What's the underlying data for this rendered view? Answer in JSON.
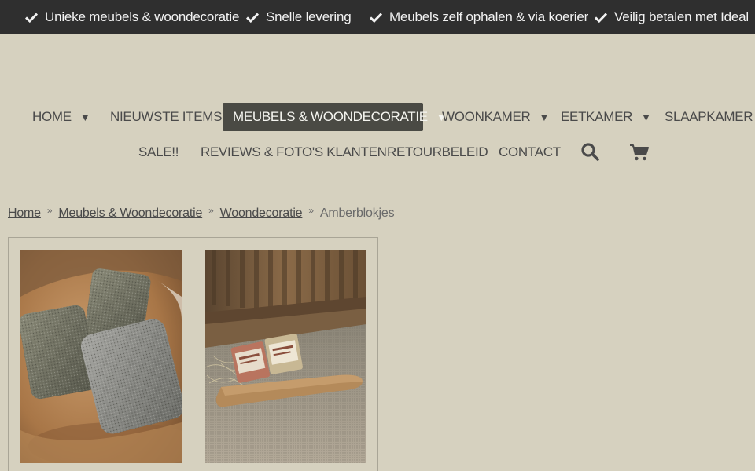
{
  "usp": [
    {
      "text": "Unieke meubels & woondecoratie",
      "icon": "check-icon"
    },
    {
      "text": "Snelle levering",
      "icon": "check-icon"
    },
    {
      "text": "Meubels zelf ophalen & via koerier",
      "icon": "check-icon"
    },
    {
      "text": "Veilig betalen met Ideal",
      "icon": "check-icon"
    }
  ],
  "nav": {
    "row1": [
      {
        "label": "HOME",
        "caret": "▼"
      },
      {
        "label": "NIEUWSTE ITEMS"
      },
      {
        "label": "MEUBELS & WOONDECORATIE",
        "caret": "▼",
        "active": true
      },
      {
        "label": "WOONKAMER",
        "caret": "▼"
      },
      {
        "label": "EETKAMER",
        "caret": "▼"
      },
      {
        "label": "SLAAPKAMER",
        "caret": "▼"
      }
    ],
    "row2": [
      {
        "label": "SALE!!"
      },
      {
        "label": "REVIEWS & FOTO'S KLANTEN"
      },
      {
        "label": "RETOURBELEID"
      },
      {
        "label": "CONTACT"
      }
    ],
    "icons": [
      "search-icon",
      "cart-icon"
    ]
  },
  "breadcrumb": {
    "items": [
      "Home",
      "Meubels & Woondecoratie",
      "Woondecoratie"
    ],
    "separator": "»",
    "current": "Amberblokjes"
  },
  "products": [
    {
      "image": "amber-blocks-in-bowl"
    },
    {
      "image": "amber-blocks-on-wooden-board"
    }
  ],
  "colors": {
    "background": "#d6d1bf",
    "topbar": "#2f2f2f",
    "nav_active": "#4a4a44",
    "text": "#4a4a4a"
  }
}
